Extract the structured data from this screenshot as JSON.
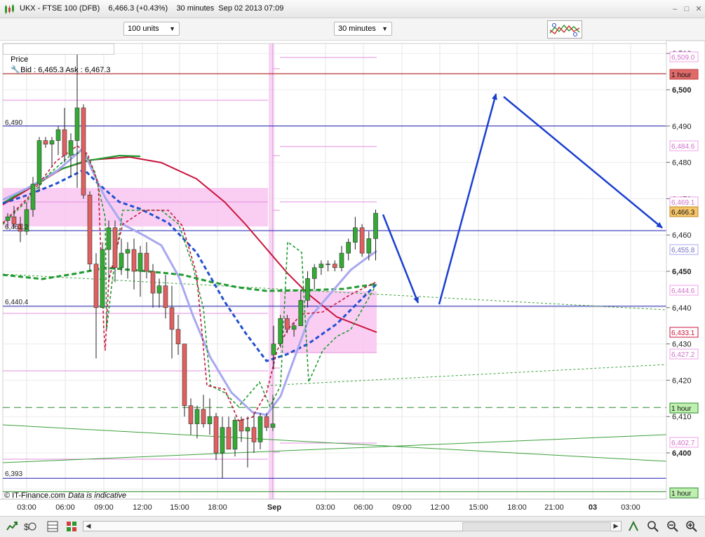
{
  "window": {
    "title": "UKX - FTSE 100 (DFB)    6,466.3 (+0.43%)    30 minutes  Sep 02 2013 07:09"
  },
  "toolbar": {
    "size_value": "100 units",
    "interval_value": "30 minutes"
  },
  "infobar": {
    "price_label": "Price",
    "quote": "Bid : 6,465.3 Ask : 6,467.3"
  },
  "axis": {
    "y_ticks": [
      "6,510",
      "6,500",
      "6,490",
      "6,480",
      "6,470",
      "6,460",
      "6,450",
      "6,440",
      "6,430",
      "6,420",
      "6,410",
      "6,400"
    ],
    "x_ticks": [
      "03:00",
      "06:00",
      "09:00",
      "12:00",
      "15:00",
      "18:00",
      "Sep",
      "03:00",
      "06:00",
      "09:00",
      "12:00",
      "15:00",
      "18:00",
      "21:00",
      "03",
      "03:00"
    ]
  },
  "price_tags": [
    {
      "text": "6,509.0",
      "kind": "pink"
    },
    {
      "text": "1 hour",
      "kind": "red"
    },
    {
      "text": "6,484.6",
      "kind": "pink"
    },
    {
      "text": "6,469.1",
      "kind": "pink"
    },
    {
      "text": "6,466.3",
      "kind": "current"
    },
    {
      "text": "6,455.8",
      "kind": "lav"
    },
    {
      "text": "6,444.6",
      "kind": "pink"
    },
    {
      "text": "6,433.1",
      "kind": "crimson"
    },
    {
      "text": "6,427.2",
      "kind": "pink"
    },
    {
      "text": "1 hour",
      "kind": "green"
    },
    {
      "text": "6,402.7",
      "kind": "pink"
    },
    {
      "text": "1 hour",
      "kind": "green"
    }
  ],
  "left_labels": [
    "6,490",
    "6,461.2",
    "6,440.4",
    "6,393"
  ],
  "footer": {
    "brand": "© IT-Finance.com",
    "note": "Data is indicative"
  },
  "colors": {
    "up": "#33aa33",
    "down": "#e06060",
    "blue_line": "#1a1ab0",
    "annot_arrow": "#1a3fd0",
    "pink_fill": "#f9c6f0",
    "red_line": "#c0103a"
  },
  "chart_data": {
    "type": "candlestick",
    "instrument": "UKX - FTSE 100 (DFB)",
    "interval": "30 minutes",
    "ylim": [
      6391,
      6514
    ],
    "horizontal_levels": [
      6504.4,
      6490,
      6461.2,
      6440.4,
      6412.5,
      6393,
      6389.3
    ],
    "candles": [
      {
        "o": 6464,
        "h": 6466,
        "l": 6462,
        "c": 6465
      },
      {
        "o": 6465,
        "h": 6468,
        "l": 6462,
        "c": 6463
      },
      {
        "o": 6463,
        "h": 6465,
        "l": 6458,
        "c": 6461
      },
      {
        "o": 6461,
        "h": 6469,
        "l": 6460,
        "c": 6467
      },
      {
        "o": 6467,
        "h": 6476,
        "l": 6465,
        "c": 6474
      },
      {
        "o": 6474,
        "h": 6487,
        "l": 6472,
        "c": 6486
      },
      {
        "o": 6486,
        "h": 6487,
        "l": 6484,
        "c": 6485
      },
      {
        "o": 6485,
        "h": 6487,
        "l": 6479,
        "c": 6486
      },
      {
        "o": 6486,
        "h": 6490,
        "l": 6482,
        "c": 6489
      },
      {
        "o": 6489,
        "h": 6495,
        "l": 6480,
        "c": 6482
      },
      {
        "o": 6482,
        "h": 6488,
        "l": 6476,
        "c": 6486
      },
      {
        "o": 6486,
        "h": 6510,
        "l": 6473,
        "c": 6495
      },
      {
        "o": 6495,
        "h": 6496,
        "l": 6470,
        "c": 6471
      },
      {
        "o": 6471,
        "h": 6472,
        "l": 6450,
        "c": 6452
      },
      {
        "o": 6452,
        "h": 6455,
        "l": 6426,
        "c": 6440
      },
      {
        "o": 6440,
        "h": 6458,
        "l": 6440,
        "c": 6456
      },
      {
        "o": 6456,
        "h": 6464,
        "l": 6448,
        "c": 6462
      },
      {
        "o": 6462,
        "h": 6464,
        "l": 6447,
        "c": 6451
      },
      {
        "o": 6451,
        "h": 6459,
        "l": 6449,
        "c": 6455
      },
      {
        "o": 6455,
        "h": 6458,
        "l": 6448,
        "c": 6456
      },
      {
        "o": 6456,
        "h": 6459,
        "l": 6445,
        "c": 6450
      },
      {
        "o": 6450,
        "h": 6457,
        "l": 6443,
        "c": 6455
      },
      {
        "o": 6455,
        "h": 6458,
        "l": 6448,
        "c": 6450
      },
      {
        "o": 6450,
        "h": 6452,
        "l": 6440,
        "c": 6444
      },
      {
        "o": 6444,
        "h": 6448,
        "l": 6440,
        "c": 6446
      },
      {
        "o": 6446,
        "h": 6449,
        "l": 6437,
        "c": 6440
      },
      {
        "o": 6440,
        "h": 6446,
        "l": 6426,
        "c": 6434
      },
      {
        "o": 6434,
        "h": 6438,
        "l": 6427,
        "c": 6430
      },
      {
        "o": 6430,
        "h": 6430,
        "l": 6410,
        "c": 6413
      },
      {
        "o": 6413,
        "h": 6415,
        "l": 6405,
        "c": 6408
      },
      {
        "o": 6408,
        "h": 6413,
        "l": 6404,
        "c": 6412
      },
      {
        "o": 6412,
        "h": 6416,
        "l": 6407,
        "c": 6408
      },
      {
        "o": 6408,
        "h": 6415,
        "l": 6405,
        "c": 6410
      },
      {
        "o": 6410,
        "h": 6411,
        "l": 6398,
        "c": 6400
      },
      {
        "o": 6400,
        "h": 6410,
        "l": 6393,
        "c": 6407
      },
      {
        "o": 6407,
        "h": 6410,
        "l": 6403,
        "c": 6401
      },
      {
        "o": 6401,
        "h": 6410,
        "l": 6399,
        "c": 6409
      },
      {
        "o": 6409,
        "h": 6410,
        "l": 6403,
        "c": 6406
      },
      {
        "o": 6406,
        "h": 6410,
        "l": 6396,
        "c": 6407
      },
      {
        "o": 6407,
        "h": 6411,
        "l": 6400,
        "c": 6403
      },
      {
        "o": 6403,
        "h": 6411,
        "l": 6401,
        "c": 6410
      },
      {
        "o": 6410,
        "h": 6411,
        "l": 6406,
        "c": 6407
      },
      {
        "o": 6407,
        "h": 6416,
        "l": 6406,
        "c": 6408
      },
      {
        "o": 6427,
        "h": 6435,
        "l": 6423,
        "c": 6430
      },
      {
        "o": 6430,
        "h": 6438,
        "l": 6429,
        "c": 6437
      },
      {
        "o": 6437,
        "h": 6438,
        "l": 6433,
        "c": 6434
      },
      {
        "o": 6434,
        "h": 6436,
        "l": 6432,
        "c": 6435
      },
      {
        "o": 6435,
        "h": 6445,
        "l": 6435,
        "c": 6442
      },
      {
        "o": 6442,
        "h": 6450,
        "l": 6440,
        "c": 6448
      },
      {
        "o": 6448,
        "h": 6452,
        "l": 6445,
        "c": 6451
      },
      {
        "o": 6451,
        "h": 6453,
        "l": 6449,
        "c": 6452
      },
      {
        "o": 6452,
        "h": 6453,
        "l": 6450,
        "c": 6452
      },
      {
        "o": 6452,
        "h": 6453,
        "l": 6450,
        "c": 6451
      },
      {
        "o": 6451,
        "h": 6457,
        "l": 6450,
        "c": 6455
      },
      {
        "o": 6455,
        "h": 6459,
        "l": 6453,
        "c": 6458
      },
      {
        "o": 6458,
        "h": 6465,
        "l": 6456,
        "c": 6462
      },
      {
        "o": 6462,
        "h": 6463,
        "l": 6454,
        "c": 6455
      },
      {
        "o": 6455,
        "h": 6461,
        "l": 6453,
        "c": 6459
      },
      {
        "o": 6459,
        "h": 6467,
        "l": 6453,
        "c": 6466
      }
    ]
  }
}
